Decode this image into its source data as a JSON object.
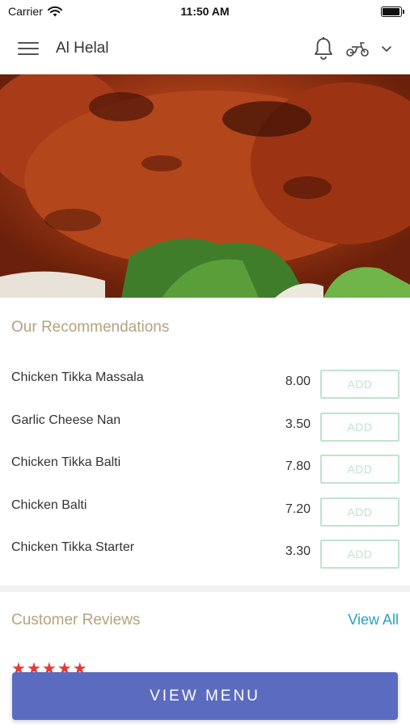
{
  "status_bar": {
    "carrier": "Carrier",
    "time": "11:50 AM",
    "battery_level": 0.95
  },
  "nav": {
    "title": "Al Helal"
  },
  "recommendations": {
    "title": "Our Recommendations",
    "items": [
      {
        "name": "Chicken Tikka Massala",
        "price": "8.00",
        "add_label": "ADD"
      },
      {
        "name": "Garlic Cheese Nan",
        "price": "3.50",
        "add_label": "ADD"
      },
      {
        "name": "Chicken Tikka Balti",
        "price": "7.80",
        "add_label": "ADD"
      },
      {
        "name": "Chicken Balti",
        "price": "7.20",
        "add_label": "ADD"
      },
      {
        "name": "Chicken Tikka Starter",
        "price": "3.30",
        "add_label": "ADD"
      }
    ]
  },
  "reviews": {
    "title": "Customer Reviews",
    "view_all": "View All",
    "rating_stars": 5
  },
  "footer": {
    "view_menu": "VIEW MENU"
  },
  "colors": {
    "accent": "#5b6bbf",
    "section_title": "#b5a27f",
    "link": "#2aa0c8",
    "add_border": "#bfe3cf",
    "star": "#e53935"
  }
}
